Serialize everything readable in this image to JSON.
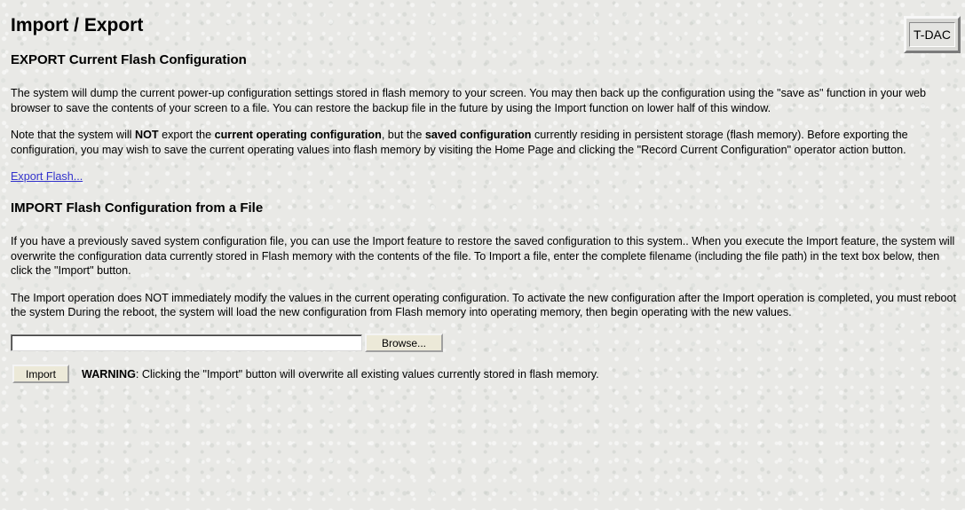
{
  "page": {
    "title": "Import / Export",
    "badge": "T-DAC"
  },
  "export_section": {
    "heading": "EXPORT Current Flash Configuration",
    "paragraph1": "The system will dump the current power-up configuration settings stored in flash memory to your screen. You may then back up the configuration using the \"save as\" function in your web browser to save the contents of your screen to a file. You can restore the backup file in the future by using the Import function on lower half of this window.",
    "paragraph2": {
      "t1": "Note that the system will ",
      "b1": "NOT",
      "t2": " export the ",
      "b2": "current operating configuration",
      "t3": ", but the ",
      "b3": "saved configuration",
      "t4": " currently residing in persistent storage (flash memory). Before exporting the configuration, you may wish to save the current operating values into flash memory by visiting the Home Page and clicking the \"Record Current Configuration\" operator action button."
    },
    "link_label": "Export Flash..."
  },
  "import_section": {
    "heading": "IMPORT Flash Configuration from a File",
    "paragraph1": "If you have a previously saved system configuration file, you can use the Import feature to restore the saved configuration to this system.. When you execute the Import feature, the system will overwrite the configuration data currently stored in Flash memory with the contents of the file. To Import a file, enter the complete filename (including the file path) in the text box below, then click the \"Import\" button.",
    "paragraph2": "The Import operation does NOT immediately modify the values in the current operating configuration. To activate the new configuration after the Import operation is completed, you must reboot the system During the reboot, the system will load the new configuration from Flash memory into operating memory, then begin operating with the new values.",
    "file_input_value": "",
    "browse_label": "Browse...",
    "import_label": "Import",
    "warning_bold": "WARNING",
    "warning_text": ": Clicking the \"Import\" button will overwrite all existing values currently stored in flash memory."
  }
}
